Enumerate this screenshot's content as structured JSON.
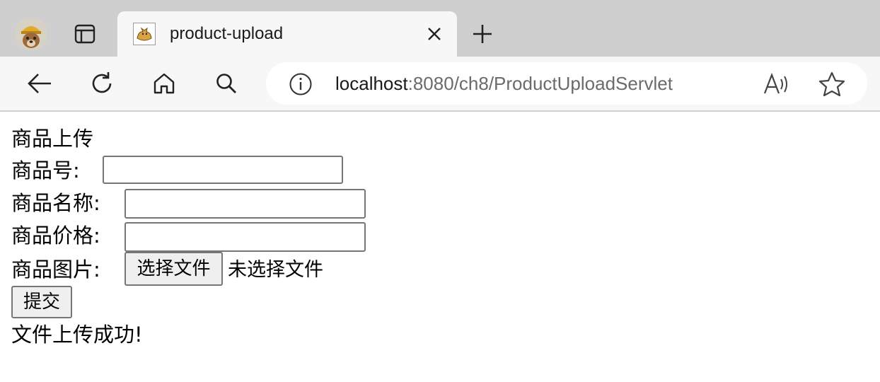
{
  "browser": {
    "tab_title": "product-upload",
    "address": {
      "host": "localhost",
      "rest": ":8080/ch8/ProductUploadServlet"
    }
  },
  "page": {
    "heading": "商品上传",
    "product_id_label": "商品号:",
    "product_name_label": "商品名称:",
    "product_price_label": "商品价格:",
    "product_image_label": "商品图片:",
    "file_button_label": "选择文件",
    "file_status": "未选择文件",
    "submit_label": "提交",
    "result_message": "文件上传成功!"
  },
  "colors": {
    "tabbar_bg": "#cfcfcf",
    "toolbar_bg": "#f7f7f7",
    "accent": "#000000"
  }
}
